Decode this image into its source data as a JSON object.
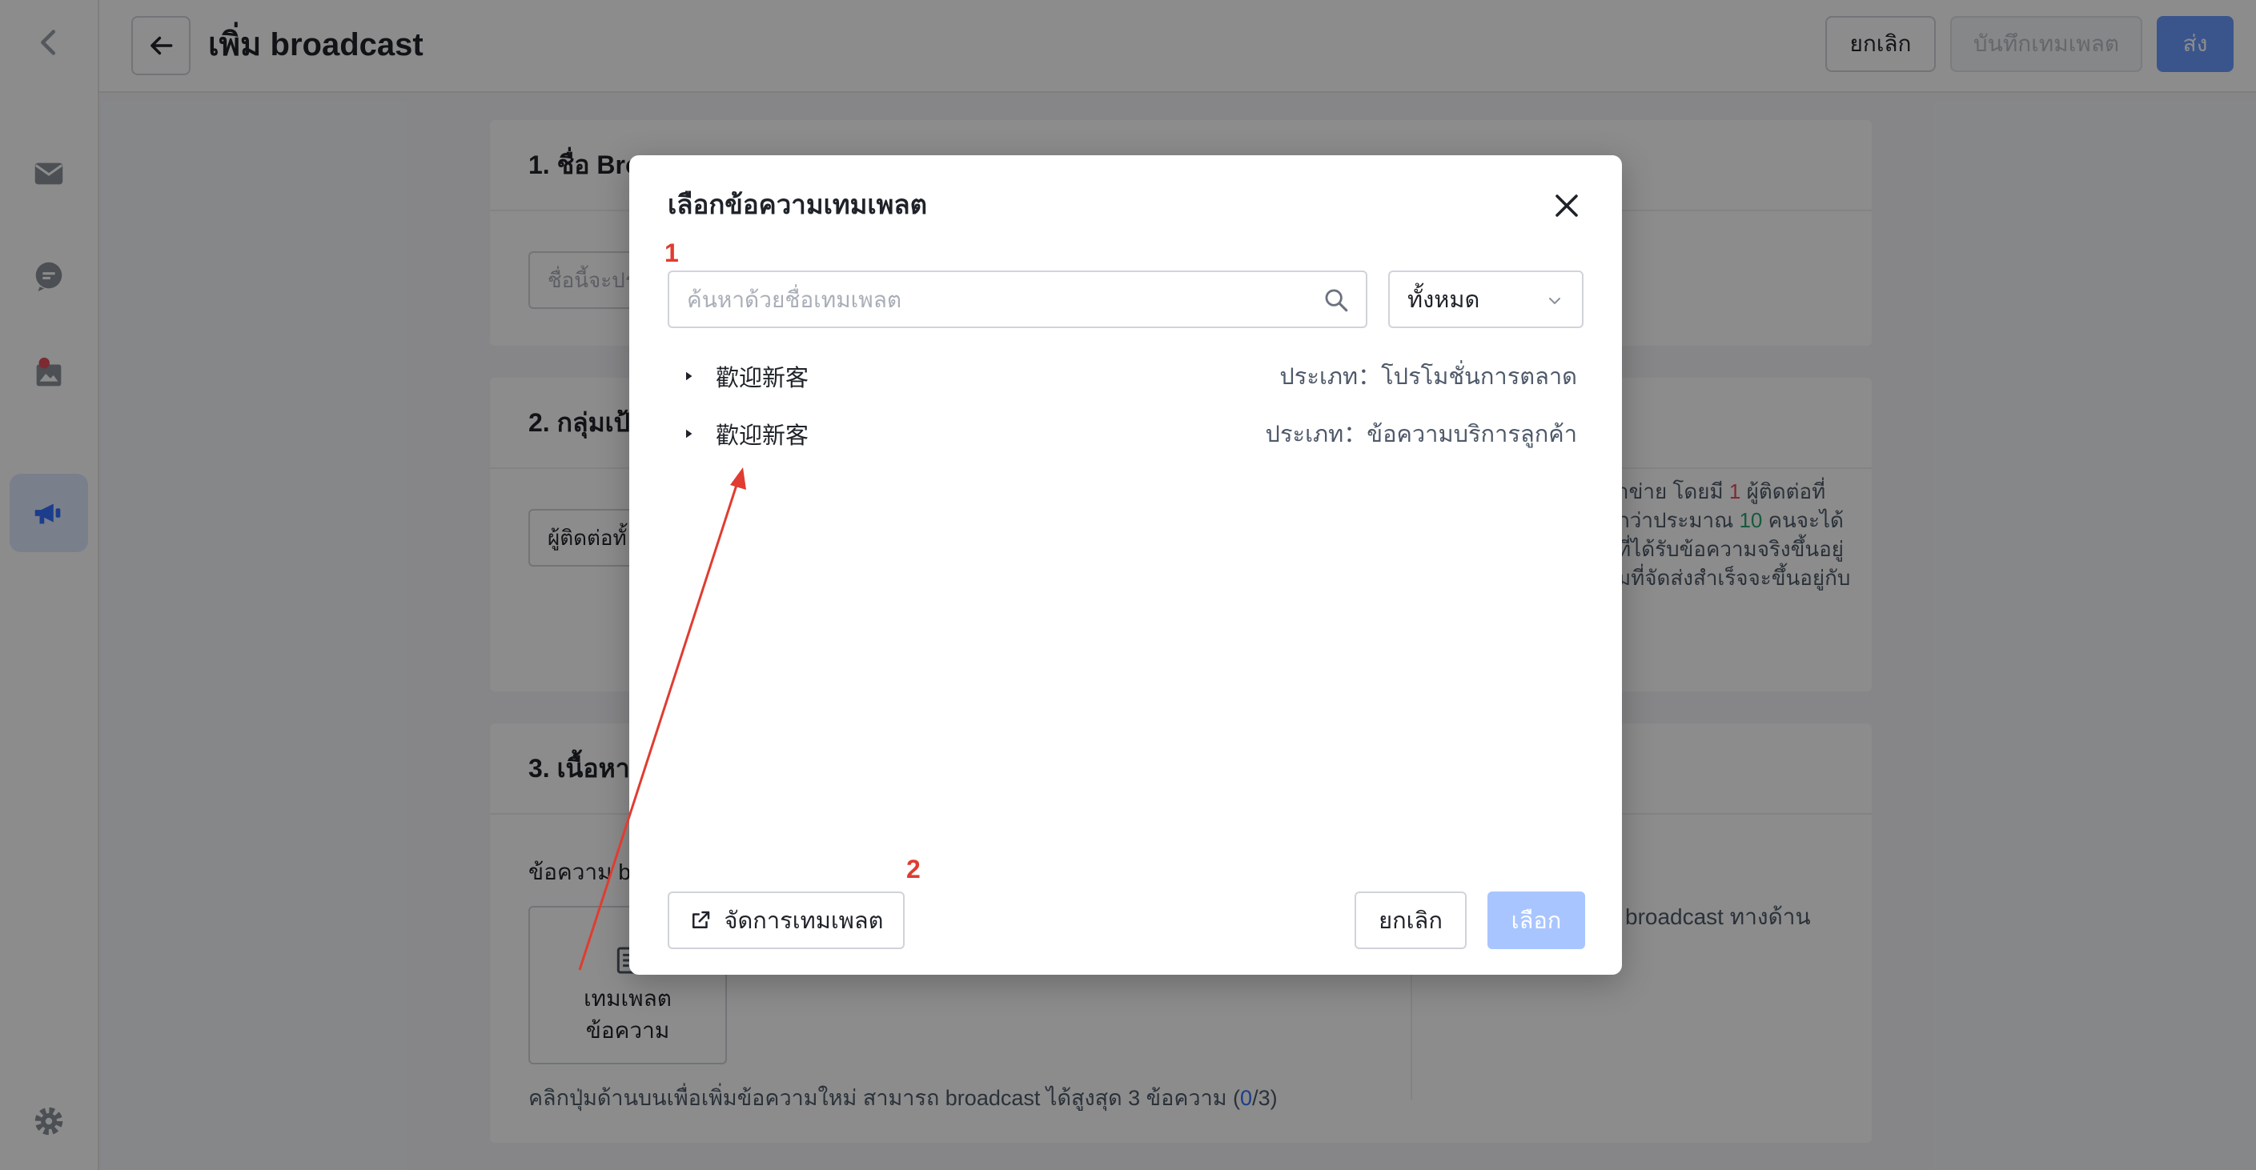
{
  "page": {
    "title": "เพิ่ม broadcast",
    "buttons": {
      "cancel": "ยกเลิก",
      "save_template": "บันทึกเทมเพลต",
      "send": "ส่ง"
    }
  },
  "sections": {
    "name": {
      "heading": "1. ชื่อ Bro",
      "input_placeholder": "ชื่อนี้จะปร"
    },
    "audience": {
      "heading": "2. กลุ่มเป้",
      "select_value": "ผู้ติดต่อทั้",
      "note_parts": [
        "าข่าย โดยมี ",
        "1",
        " ผู้ติดต่อที่",
        "กว่าประมาณ ",
        "10",
        " คนจะได้",
        "ที่ได้รับข้อความจริงขึ้นอยู่",
        "มที่จัดส่งสำเร็จจะขึ้นอยู่กับ"
      ]
    },
    "content": {
      "heading": "3. เนื้อหา",
      "label": "ข้อความ br",
      "tile_line1": "เทมเพลต",
      "tile_line2": "ข้อความ",
      "hint_prefix": "คลิกปุ่มด้านบนเพื่อเพิ่มข้อความใหม่ สามารถ broadcast ได้สูงสุด 3 ข้อความ  (",
      "hint_count": "0",
      "hint_suffix": "/3)",
      "preview_text": "broadcast ทางด้าน"
    }
  },
  "modal": {
    "title": "เลือกข้อความเทมเพลต",
    "search_placeholder": "ค้นหาด้วยชื่อเทมเพลต",
    "filter_value": "ทั้งหมด",
    "templates": [
      {
        "name": "歡迎新客",
        "type": "ประเภท：โปรโมชั่นการตลาด"
      },
      {
        "name": "歡迎新客",
        "type": "ประเภท：ข้อความบริการลูกค้า"
      }
    ],
    "manage_label": "จัดการเทมเพลต",
    "cancel_label": "ยกเลิก",
    "select_label": "เลือก"
  },
  "annotations": {
    "first": "1",
    "second": "2"
  },
  "colors": {
    "primary": "#3370ff",
    "primary_disabled": "#a8c5ff",
    "annotation": "#e03c31"
  }
}
